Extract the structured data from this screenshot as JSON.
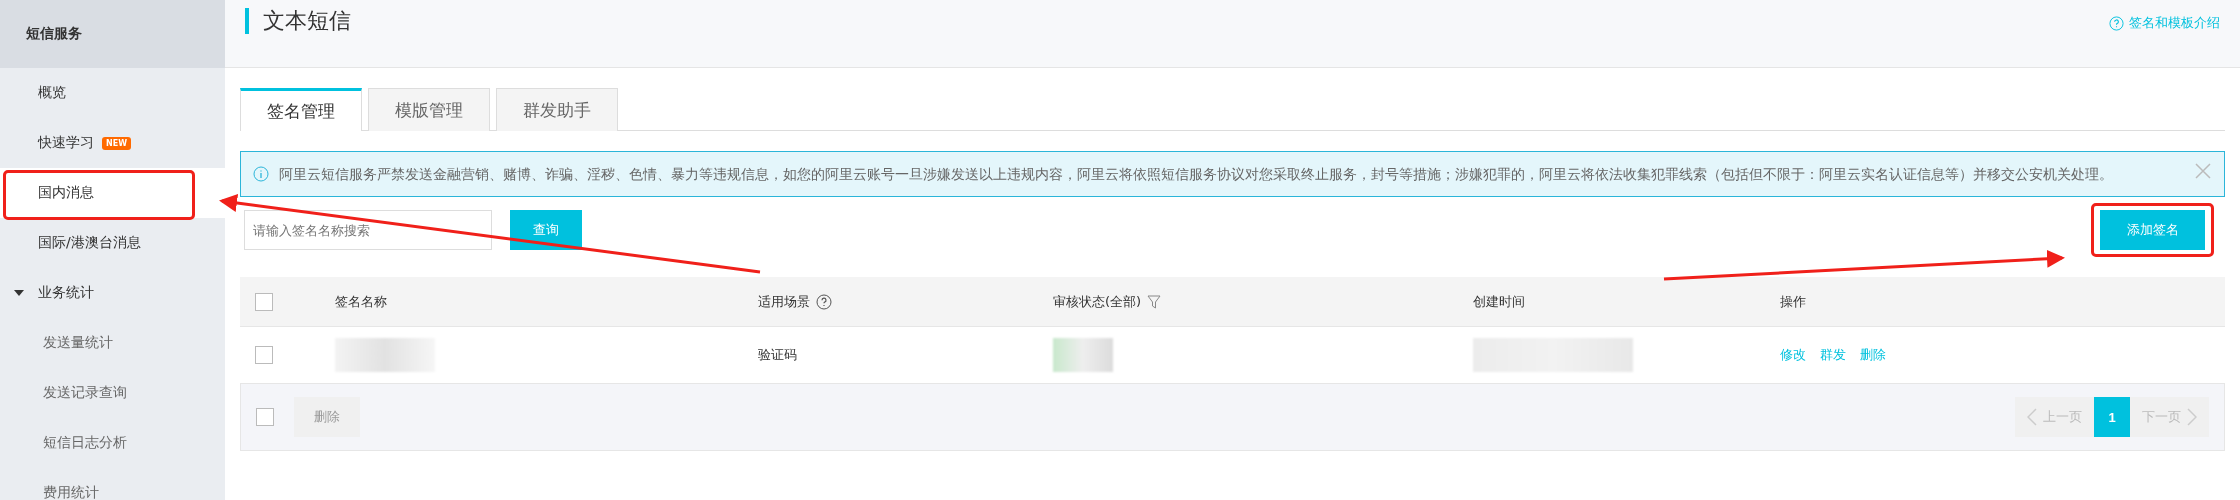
{
  "sidebar": {
    "title": "短信服务",
    "items": [
      {
        "label": "概览",
        "selected": false
      },
      {
        "label": "快速学习",
        "badge": "NEW",
        "selected": false
      },
      {
        "label": "国内消息",
        "selected": true,
        "highlighted": true
      },
      {
        "label": "国际/港澳台消息",
        "selected": false
      },
      {
        "label": "业务统计",
        "selected": false,
        "expanded": true,
        "children": [
          {
            "label": "发送量统计",
            "selected": false
          },
          {
            "label": "发送记录查询",
            "selected": false
          },
          {
            "label": "短信日志分析",
            "selected": false
          },
          {
            "label": "费用统计",
            "selected": false
          }
        ]
      }
    ]
  },
  "header": {
    "title": "文本短信",
    "help_link": "签名和模板介绍"
  },
  "tabs": [
    {
      "label": "签名管理",
      "selected": true
    },
    {
      "label": "模版管理",
      "selected": false
    },
    {
      "label": "群发助手",
      "selected": false
    }
  ],
  "notice": {
    "text": "阿里云短信服务严禁发送金融营销、赌博、诈骗、淫秽、色情、暴力等违规信息，如您的阿里云账号一旦涉嫌发送以上违规内容，阿里云将依照短信服务协议对您采取终止服务，封号等措施；涉嫌犯罪的，阿里云将依法收集犯罪线索（包括但不限于：阿里云实名认证信息等）并移交公安机关处理。"
  },
  "search": {
    "placeholder": "请输入签名名称搜索",
    "button": "查询"
  },
  "add_button": {
    "label": "添加签名",
    "highlighted": true
  },
  "table": {
    "header_checked": false,
    "columns": [
      "签名名称",
      "适用场景",
      "审核状态(全部)",
      "创建时间",
      "操作"
    ],
    "rows": [
      {
        "checked": false,
        "scene": "验证码",
        "actions": [
          "修改",
          "群发",
          "删除"
        ]
      }
    ],
    "footer": {
      "checked": false,
      "delete": {
        "label": "删除",
        "disabled": true
      }
    }
  },
  "pagination": {
    "prev": {
      "label": "上一页",
      "disabled": true
    },
    "pages": [
      {
        "label": "1",
        "selected": true
      }
    ],
    "next": {
      "label": "下一页",
      "disabled": true
    }
  }
}
